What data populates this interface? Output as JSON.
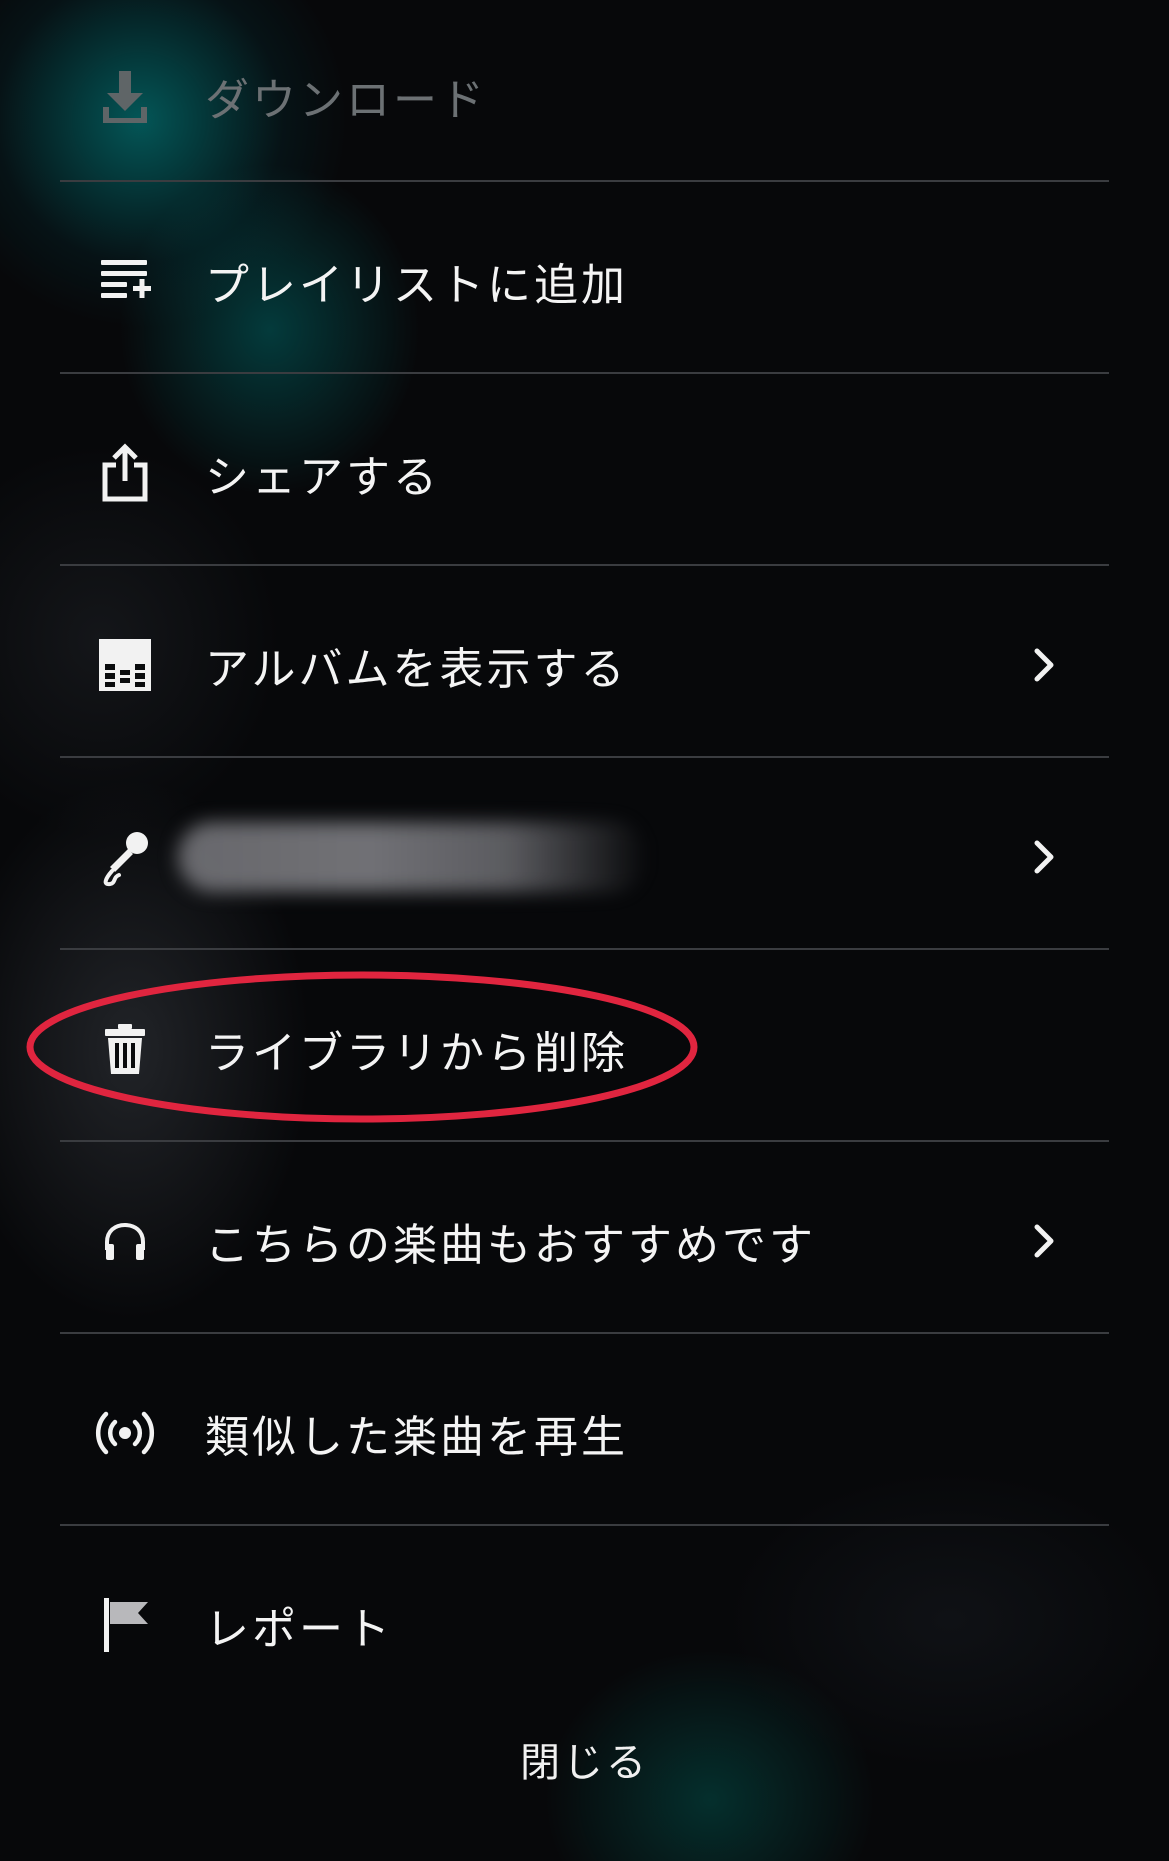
{
  "menu": {
    "items": [
      {
        "label": "ダウンロード",
        "icon": "download-icon",
        "disabled": true
      },
      {
        "label": "プレイリストに追加",
        "icon": "add-to-playlist-icon"
      },
      {
        "label": "シェアする",
        "icon": "share-icon"
      },
      {
        "label": "アルバムを表示する",
        "icon": "album-icon",
        "chevron": true
      },
      {
        "label": "",
        "icon": "microphone-icon",
        "chevron": true,
        "redacted": true
      },
      {
        "label": "ライブラリから削除",
        "icon": "trash-icon",
        "highlighted": true
      },
      {
        "label": "こちらの楽曲もおすすめです",
        "icon": "headphones-icon",
        "chevron": true
      },
      {
        "label": "類似した楽曲を再生",
        "icon": "radio-broadcast-icon"
      },
      {
        "label": "レポート",
        "icon": "flag-icon"
      }
    ]
  },
  "close_label": "閉じる",
  "colors": {
    "background": "#07080a",
    "text": "#f4f4f4",
    "disabled_text": "#6c7174",
    "divider": "#3a3c40",
    "highlight": "#e0253f"
  }
}
